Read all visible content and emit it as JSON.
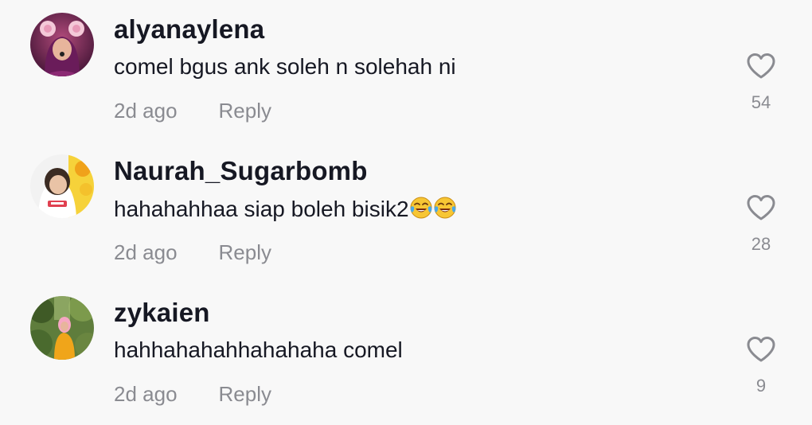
{
  "comments": [
    {
      "username": "alyanaylena",
      "text": "comel bgus ank soleh n solehah ni",
      "time": "2d ago",
      "reply_label": "Reply",
      "likes": "54",
      "avatar_icon": "avatar-bear-ears-filter-icon"
    },
    {
      "username": "Naurah_Sugarbomb",
      "text": "hahahahhaa siap boleh bisik2",
      "emojis": [
        "face-with-tears-of-joy-icon",
        "face-with-tears-of-joy-icon"
      ],
      "time": "2d ago",
      "reply_label": "Reply",
      "likes": "28",
      "avatar_icon": "avatar-hijab-girl-icon"
    },
    {
      "username": "zykaien",
      "text": "hahhahahahhahahaha comel",
      "time": "2d ago",
      "reply_label": "Reply",
      "likes": "9",
      "avatar_icon": "avatar-outdoor-yellow-shirt-icon"
    }
  ],
  "colors": {
    "background": "#f8f8f8",
    "primary_text": "#161823",
    "secondary_text": "#8a8b91",
    "heart_outline": "#8a8b91"
  }
}
